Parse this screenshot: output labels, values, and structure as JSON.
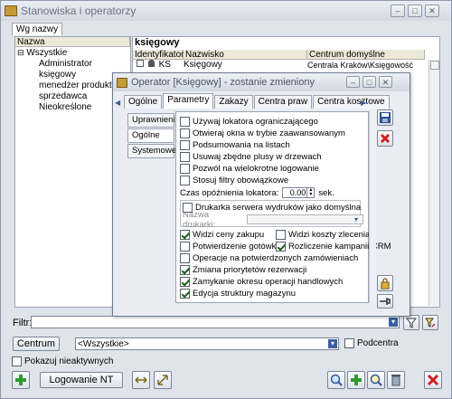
{
  "window": {
    "title": "Stanowiska i operatorzy",
    "tab_label": "Wg nazwy"
  },
  "tree": {
    "header": "Nazwa",
    "root": "Wszystkie",
    "items": [
      "Administrator",
      "księgowy",
      "menedżer produktu",
      "sprzedawca",
      "Nieokreślone"
    ]
  },
  "grid": {
    "title": "księgowy",
    "columns": [
      "Identyfikator",
      "Nazwisko",
      "Centrum domyślne"
    ],
    "rows": [
      {
        "id": "KS",
        "name": "Księgowy",
        "center": "Centrala Kraków\\Księgowość"
      }
    ]
  },
  "filter": {
    "label": "Filtr:",
    "value": ""
  },
  "center": {
    "button_label": "Centrum",
    "value": "<Wszystkie>",
    "subcenters_label": "Podcentra"
  },
  "show_inactive_label": "Pokazuj nieaktywnych",
  "logon_nt_label": "Logowanie NT",
  "dialog": {
    "title": "Operator [Księgowy] - zostanie zmieniony",
    "tabs": [
      "Ogólne",
      "Parametry",
      "Zakazy",
      "Centra praw",
      "Centra kosztowe"
    ],
    "active_tab": "Parametry",
    "side_tabs": [
      "Uprawnienia",
      "Ogólne",
      "Systemowe"
    ],
    "options_top": [
      {
        "label": "Używaj lokatora ograniczającego",
        "checked": false
      },
      {
        "label": "Otwieraj okna w trybie zaawansowanym",
        "checked": false
      },
      {
        "label": "Podsumowania na listach",
        "checked": false
      },
      {
        "label": "Usuwaj zbędne plusy w drzewach",
        "checked": false
      },
      {
        "label": "Pozwól na wielokrotne logowanie",
        "checked": false
      },
      {
        "label": "Stosuj filtry obowiązkowe",
        "checked": false
      }
    ],
    "delay_label": "Czas opóźnienia lokatora:",
    "delay_value": "0.00",
    "delay_unit": "sek.",
    "print_server_label": "Drukarka serwera wydruków jako domyślna",
    "printer_name_label": "Nazwa drukarki:",
    "grid_opts": [
      {
        "label": "Widzi ceny zakupu",
        "checked": true
      },
      {
        "label": "Widzi koszty zlecenia",
        "checked": false
      },
      {
        "label": "Potwierdzenie gotówki",
        "checked": false
      },
      {
        "label": "Rozliczenie kampanii CRM",
        "checked": true
      }
    ],
    "options_bottom": [
      {
        "label": "Operacje na potwierdzonych zamówieniach",
        "checked": false
      },
      {
        "label": "Zmiana priorytetów rezerwacji",
        "checked": true
      },
      {
        "label": "Zamykanie okresu operacji handlowych",
        "checked": true
      },
      {
        "label": "Edycja struktury magazynu",
        "checked": true
      }
    ]
  },
  "colors": {
    "accent": "#3a6ea5",
    "red": "#d21f1f",
    "green": "#2f9a2f"
  }
}
